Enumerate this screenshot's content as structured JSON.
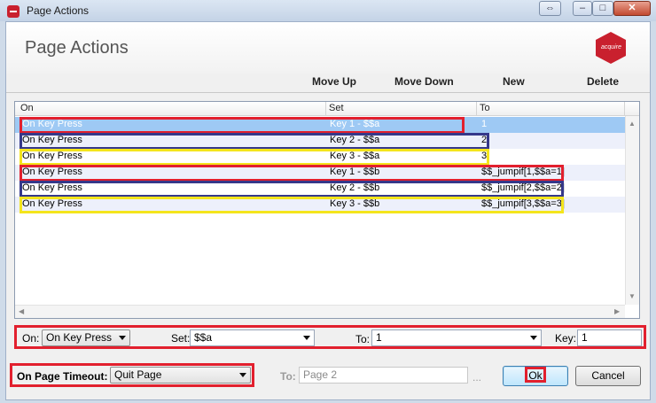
{
  "window": {
    "title": "Page Actions"
  },
  "header": {
    "heading": "Page Actions",
    "logo_text": "acquire"
  },
  "toolbar": {
    "move_up": "Move Up",
    "move_down": "Move Down",
    "new": "New",
    "delete": "Delete"
  },
  "grid": {
    "columns": [
      "On",
      "Set",
      "To"
    ],
    "rows": [
      {
        "on": "On Key Press",
        "set": "Key 1 - $$a",
        "to": "1"
      },
      {
        "on": "On Key Press",
        "set": "Key 2 - $$a",
        "to": "2"
      },
      {
        "on": "On Key Press",
        "set": "Key 3 - $$a",
        "to": "3"
      },
      {
        "on": "On Key Press",
        "set": "Key 1 - $$b",
        "to": "$$_jumpif[1,$$a=1]"
      },
      {
        "on": "On Key Press",
        "set": "Key 2 - $$b",
        "to": "$$_jumpif[2,$$a=2]"
      },
      {
        "on": "On Key Press",
        "set": "Key 3 - $$b",
        "to": "$$_jumpif[3,$$a=3]"
      }
    ]
  },
  "editor": {
    "on_label": "On:",
    "on_value": "On Key Press",
    "set_label": "Set:",
    "set_value": "$$a",
    "to_label": "To:",
    "to_value": "1",
    "key_label": "Key:",
    "key_value": "1"
  },
  "footer": {
    "timeout_label": "On Page Timeout:",
    "timeout_value": "Quit Page",
    "to_label": "To:",
    "to_value": "Page 2",
    "browse": "...",
    "ok": "Ok",
    "cancel": "Cancel"
  },
  "colors": {
    "highlight_red": "#e2202e",
    "highlight_blue": "#35388a",
    "highlight_yellow": "#f4e51c",
    "selected_row": "#9ec9f4"
  }
}
